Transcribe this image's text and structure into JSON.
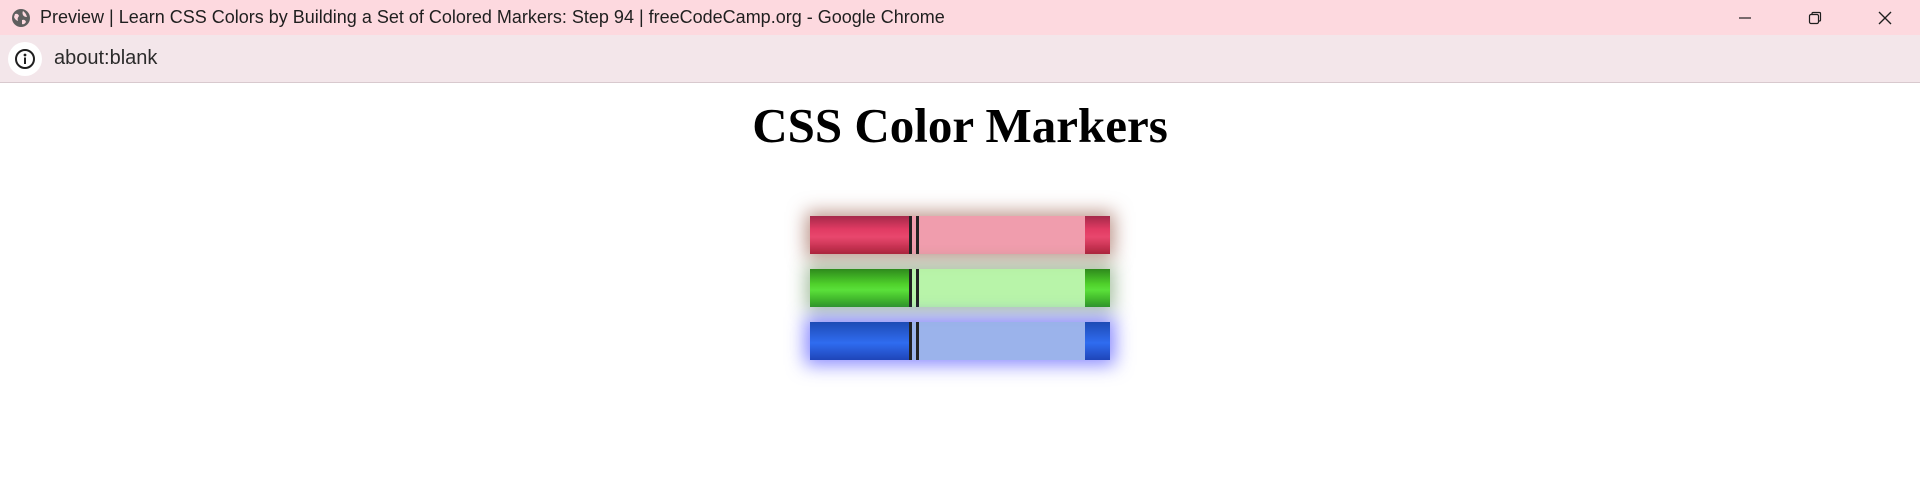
{
  "window": {
    "title": "Preview | Learn CSS Colors by Building a Set of Colored Markers: Step 94 | freeCodeCamp.org - Google Chrome",
    "favicon_icon": "globe-icon",
    "controls": {
      "minimize_icon": "minimize-icon",
      "restore_icon": "restore-icon",
      "close_icon": "close-icon"
    }
  },
  "addressbar": {
    "info_icon": "info-icon",
    "url": "about:blank"
  },
  "page": {
    "heading": "CSS Color Markers",
    "markers": [
      {
        "color": "red",
        "cap_color": "#e13b63",
        "sleeve_color": "#ec8296",
        "shadow_color": "#853c28"
      },
      {
        "color": "green",
        "cap_color": "#4fd12b",
        "sleeve_color": "#a0f08c",
        "shadow_color": "#326e28"
      },
      {
        "color": "blue",
        "cap_color": "#2b63e0",
        "sleeve_color": "#82a0e6",
        "shadow_color": "#3c3cff"
      }
    ]
  },
  "colors": {
    "titlebar_bg": "#fdd9df",
    "addressbar_bg": "#f3e6ea",
    "page_bg": "#ffffff"
  }
}
